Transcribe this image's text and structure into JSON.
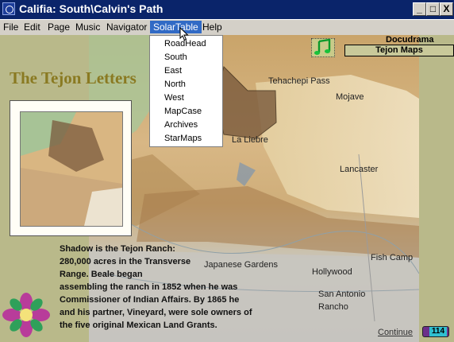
{
  "window": {
    "title": "Califia: South\\Calvin's Path",
    "minimize": "_",
    "maximize": "□",
    "close": "X"
  },
  "menubar": {
    "items": [
      "File",
      "Edit",
      "Page",
      "Music",
      "Navigator",
      "SolarTable",
      "Help"
    ]
  },
  "dropdown": {
    "items": [
      "RoadHead",
      "South",
      "East",
      "North",
      "West",
      "MapCase",
      "Archives",
      "StarMaps"
    ]
  },
  "map_labels": {
    "tehachapi": "Tehachepi Pass",
    "mojave": "Mojave",
    "lalebre": "La Liebre",
    "lancaster": "Lancaster",
    "japanese": "Japanese Gardens",
    "fishcamp": "Fish Camp",
    "hollywood": "Hollywood",
    "sanantonio1": "San Antonio",
    "sanantonio2": "Rancho"
  },
  "page": {
    "heading": "The Tejon Letters",
    "body_lines": [
      "Shadow is the Tejon Ranch:",
      "280,000 acres in the Transverse",
      "Range.  Beale began",
      "assembling the ranch in 1852 when he was",
      "Commissioner of Indian Affairs.  By 1865 he",
      "and his partner, Vineyard, were sole owners of",
      "the five original Mexican Land Grants."
    ]
  },
  "side": {
    "docudrama": "Docudrama",
    "tejon_maps": "Tejon Maps"
  },
  "footer": {
    "continue": "Continue",
    "page_number": "114"
  },
  "colors": {
    "background": "#b9b98a",
    "titlebar": "#0a246a",
    "menu_active": "#316ac5",
    "heading": "#8a7a22"
  },
  "icons": {
    "music": "music-note-icon",
    "logo": "califia-flower-logo-icon"
  }
}
